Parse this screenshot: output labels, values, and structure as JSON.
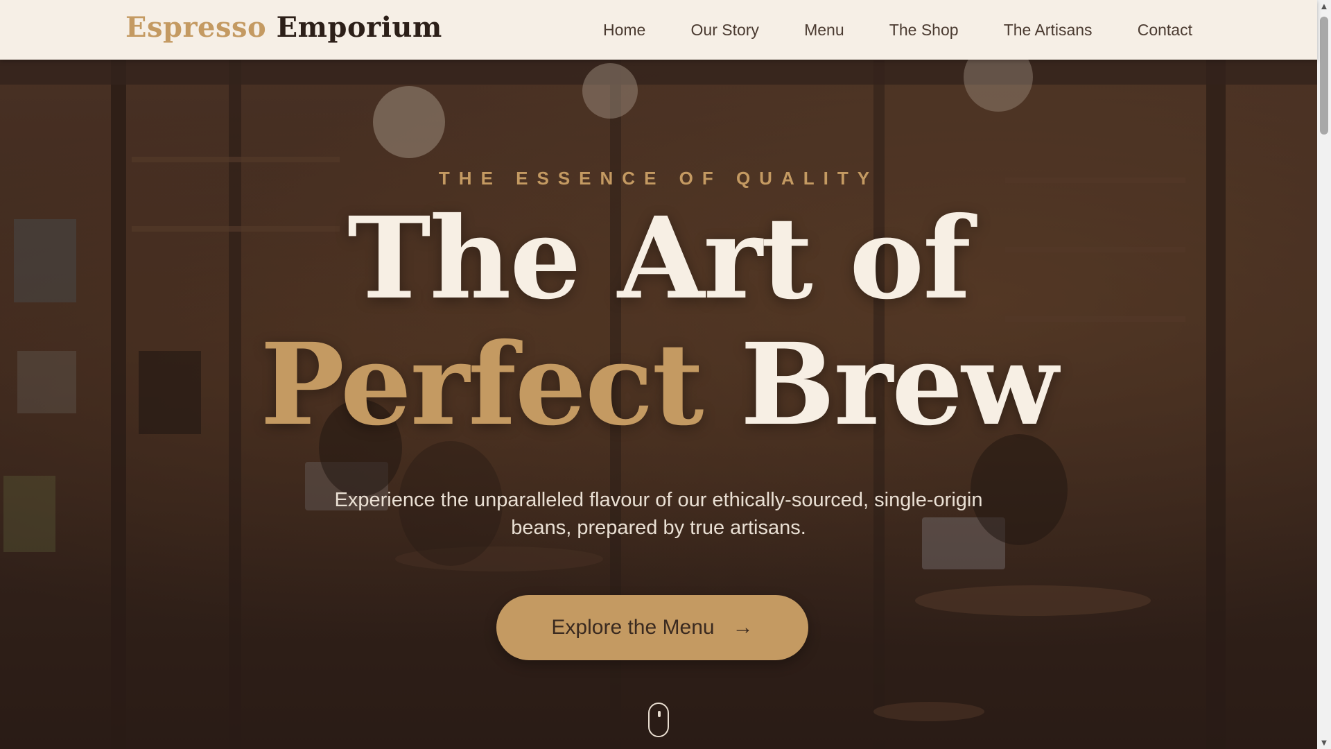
{
  "header": {
    "brand_first": "Espresso",
    "brand_second": "Emporium",
    "nav": [
      {
        "label": "Home"
      },
      {
        "label": "Our Story"
      },
      {
        "label": "Menu"
      },
      {
        "label": "The Shop"
      },
      {
        "label": "The Artisans"
      },
      {
        "label": "Contact"
      }
    ]
  },
  "hero": {
    "eyebrow": "THE ESSENCE OF QUALITY",
    "headline_line1": "The Art of",
    "headline_accent": "Perfect",
    "headline_rest": "Brew",
    "subtext": "Experience the unparalleled flavour of our ethically-sourced, single-origin beans, prepared by true artisans.",
    "cta_label": "Explore the Menu",
    "cta_icon": "arrow-right-icon",
    "scroll_icon": "mouse-scroll-icon"
  },
  "colors": {
    "accent": "#c49a62",
    "header_bg": "#f6efe6",
    "dark_text": "#2c1f18",
    "hero_text": "#f7efe4"
  }
}
